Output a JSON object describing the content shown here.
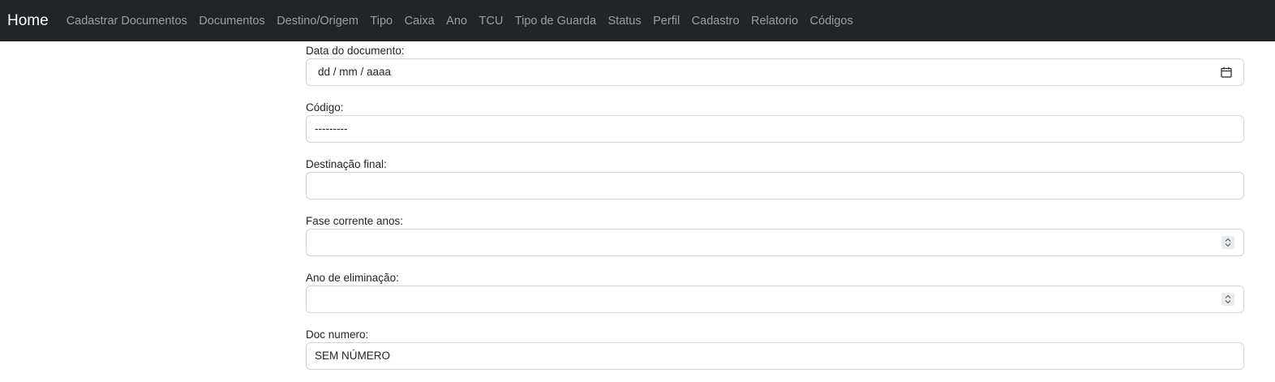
{
  "navbar": {
    "brand": "Home",
    "links": [
      "Cadastrar Documentos",
      "Documentos",
      "Destino/Origem",
      "Tipo",
      "Caixa",
      "Ano",
      "TCU",
      "Tipo de Guarda",
      "Status",
      "Perfil",
      "Cadastro",
      "Relatorio",
      "Códigos"
    ]
  },
  "form": {
    "data_documento": {
      "label": "Data do documento:",
      "value": "dd / mm / aaaa",
      "icon": "calendar-icon"
    },
    "codigo": {
      "label": "Código:",
      "value": "---------"
    },
    "destinacao_final": {
      "label": "Destinação final:",
      "value": ""
    },
    "fase_corrente_anos": {
      "label": "Fase corrente anos:",
      "value": "",
      "icon": "spinner-icon"
    },
    "ano_eliminacao": {
      "label": "Ano de eliminação:",
      "value": "",
      "icon": "spinner-icon"
    },
    "doc_numero": {
      "label": "Doc numero:",
      "value": "SEM NÚMERO"
    }
  }
}
